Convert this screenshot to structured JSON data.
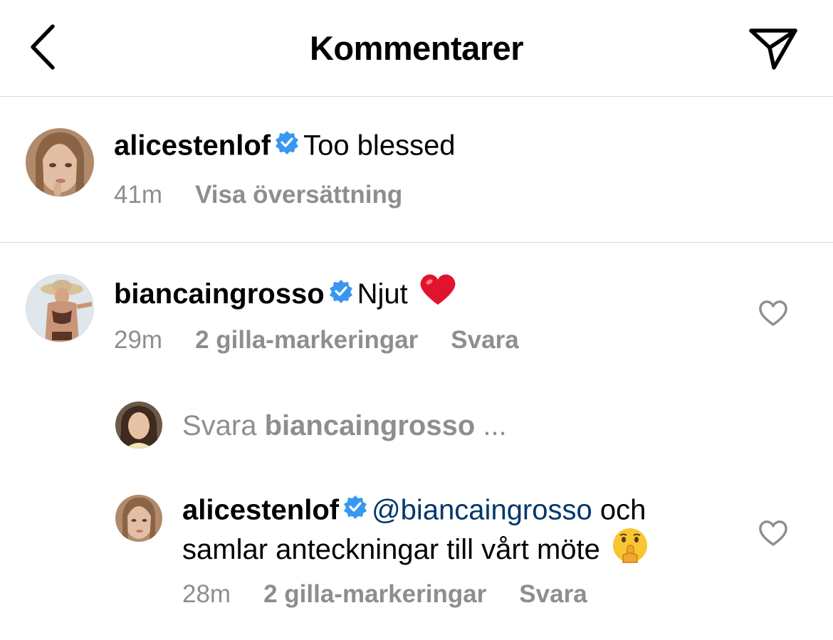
{
  "header": {
    "title": "Kommentarer",
    "back_icon": "chevron-left-icon",
    "share_icon": "paper-plane-icon"
  },
  "caption": {
    "username": "alicestenlof",
    "text": "Too blessed",
    "time": "41m",
    "translate": "Visa översättning"
  },
  "comment1": {
    "username": "biancaingrosso",
    "text": "Njut",
    "emoji": "heart-emoji",
    "time": "29m",
    "likes": "2 gilla-markeringar",
    "reply": "Svara"
  },
  "reply_prompt": {
    "prefix": "Svara",
    "username": "biancaingrosso",
    "ellipsis": "..."
  },
  "comment2": {
    "username": "alicestenlof",
    "mention": "@biancaingrosso",
    "text_line1": "och",
    "text_line2": "samlar anteckningar till vårt möte",
    "emoji": "shushing-face-emoji",
    "time": "28m",
    "likes": "2 gilla-markeringar",
    "reply": "Svara"
  },
  "colors": {
    "verified": "#3897f0",
    "meta_text": "#8e8e8e",
    "mention": "#00376b",
    "divider": "#dbdbdb"
  }
}
